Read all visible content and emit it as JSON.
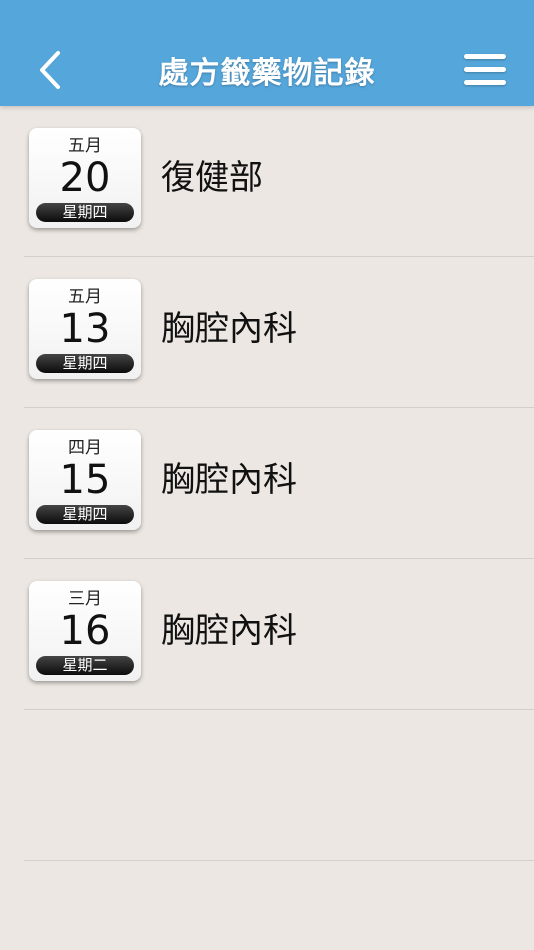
{
  "header": {
    "title": "處方籤藥物記錄",
    "back_icon": "chevron-left-icon",
    "menu_icon": "hamburger-menu-icon"
  },
  "colors": {
    "navbar": "#55a6db",
    "background": "#ece7e2"
  },
  "records": [
    {
      "month": "五月",
      "day": "20",
      "weekday": "星期四",
      "department": "復健部"
    },
    {
      "month": "五月",
      "day": "13",
      "weekday": "星期四",
      "department": "胸腔內科"
    },
    {
      "month": "四月",
      "day": "15",
      "weekday": "星期四",
      "department": "胸腔內科"
    },
    {
      "month": "三月",
      "day": "16",
      "weekday": "星期二",
      "department": "胸腔內科"
    }
  ]
}
